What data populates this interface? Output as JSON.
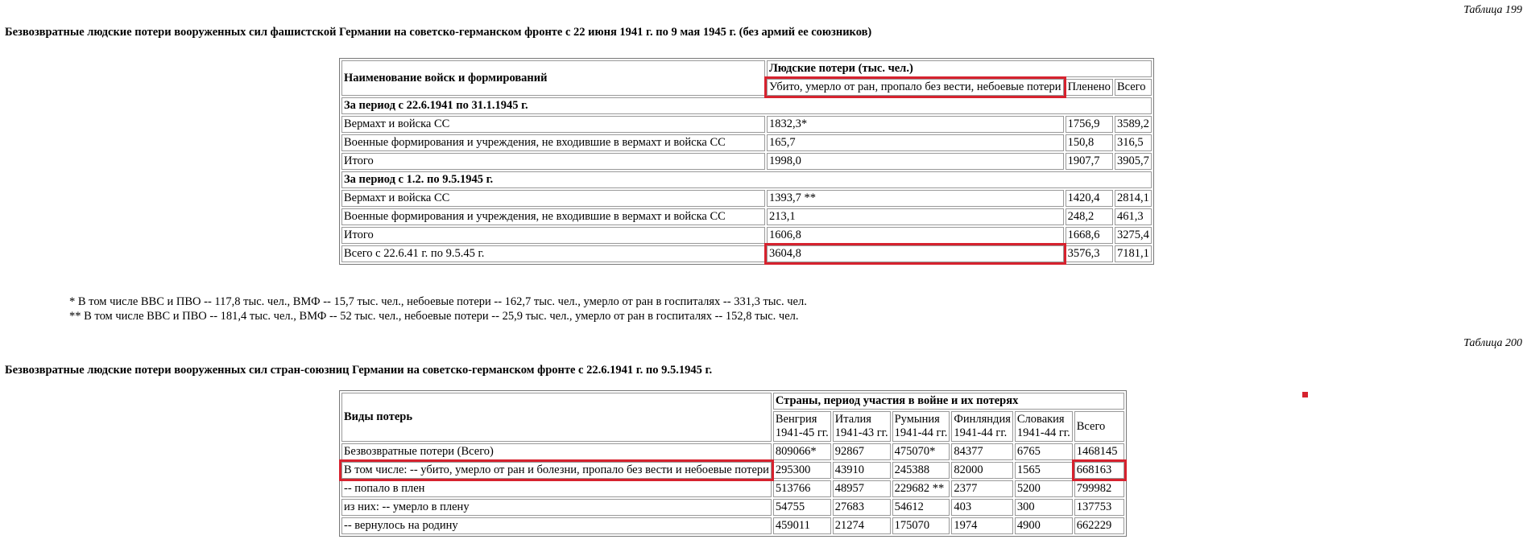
{
  "table1": {
    "caption": "Таблица 199",
    "title": "Безвозвратные людские потери вооруженных сил фашистской Германии на советско-германском фронте с 22 июня 1941 г. по 9 мая 1945 г. (без армий ее союзников)",
    "headers": {
      "troops": "Наименование войск и формирований",
      "losses": "Людские потери (тыс. чел.)",
      "killed": "Убито, умерло от ран, пропало без вести, небоевые потери",
      "captured": "Пленено",
      "total": "Всего"
    },
    "period1": "За период с 22.6.1941 по 31.1.1945 г.",
    "period1_rows": [
      [
        "Вермахт и войска СС",
        "1832,3*",
        "1756,9",
        "3589,2"
      ],
      [
        "Военные формирования и учреждения, не входившие в вермахт и войска СС",
        "165,7",
        "150,8",
        "316,5"
      ],
      [
        "Итого",
        "1998,0",
        "1907,7",
        "3905,7"
      ]
    ],
    "period2": "За период с 1.2. по 9.5.1945 г.",
    "period2_rows": [
      [
        "Вермахт и войска СС",
        "1393,7 **",
        "1420,4",
        "2814,1"
      ],
      [
        "Военные формирования и учреждения, не входившие в вермахт и войска СС",
        "213,1",
        "248,2",
        "461,3"
      ],
      [
        "Итого",
        "1606,8",
        "1668,6",
        "3275,4"
      ]
    ],
    "grand_total": [
      "Всего с 22.6.41 г. по 9.5.45 г.",
      "3604,8",
      "3576,3",
      "7181,1"
    ],
    "notes": [
      "* В том числе ВВС и ПВО -- 117,8 тыс. чел., ВМФ -- 15,7 тыс. чел., небоевые потери -- 162,7 тыс. чел., умерло от ран в госпиталях -- 331,3 тыс. чел.",
      "** В том числе ВВС и ПВО -- 181,4 тыс. чел., ВМФ -- 52 тыс. чел., небоевые потери -- 25,9 тыс. чел., умерло от ран в госпиталях -- 152,8 тыс. чел."
    ]
  },
  "table2": {
    "caption": "Таблица 200",
    "title": "Безвозвратные людские потери вооруженных сил стран-союзниц Германии на советско-германском фронте с 22.6.1941 г. по 9.5.1945 г.",
    "headers": {
      "kinds": "Виды потерь",
      "countries": "Страны, период участия в войне и их потерях",
      "cols": [
        [
          "Венгрия",
          "1941-45 гг."
        ],
        [
          "Италия",
          "1941-43 гг."
        ],
        [
          "Румыния",
          "1941-44 гг."
        ],
        [
          "Финляндия",
          "1941-44 гг."
        ],
        [
          "Словакия",
          "1941-44 гг."
        ],
        [
          "Всего",
          ""
        ]
      ]
    },
    "rows": [
      [
        "Безвозвратные потери (Всего)",
        "809066*",
        "92867",
        "475070*",
        "84377",
        "6765",
        "1468145"
      ],
      [
        "В том числе: -- убито, умерло от ран и болезни, пропало без вести и небоевые потери",
        "295300",
        "43910",
        "245388",
        "82000",
        "1565",
        "668163"
      ],
      [
        "-- попало в плен",
        "513766",
        "48957",
        "229682 **",
        "2377",
        "5200",
        "799982"
      ],
      [
        "из них: -- умерло в плену",
        "54755",
        "27683",
        "54612",
        "403",
        "300",
        "137753"
      ],
      [
        "-- вернулось на родину",
        "459011",
        "21274",
        "175070",
        "1974",
        "4900",
        "662229"
      ]
    ]
  },
  "colors": {
    "highlight": "#d6222e"
  }
}
